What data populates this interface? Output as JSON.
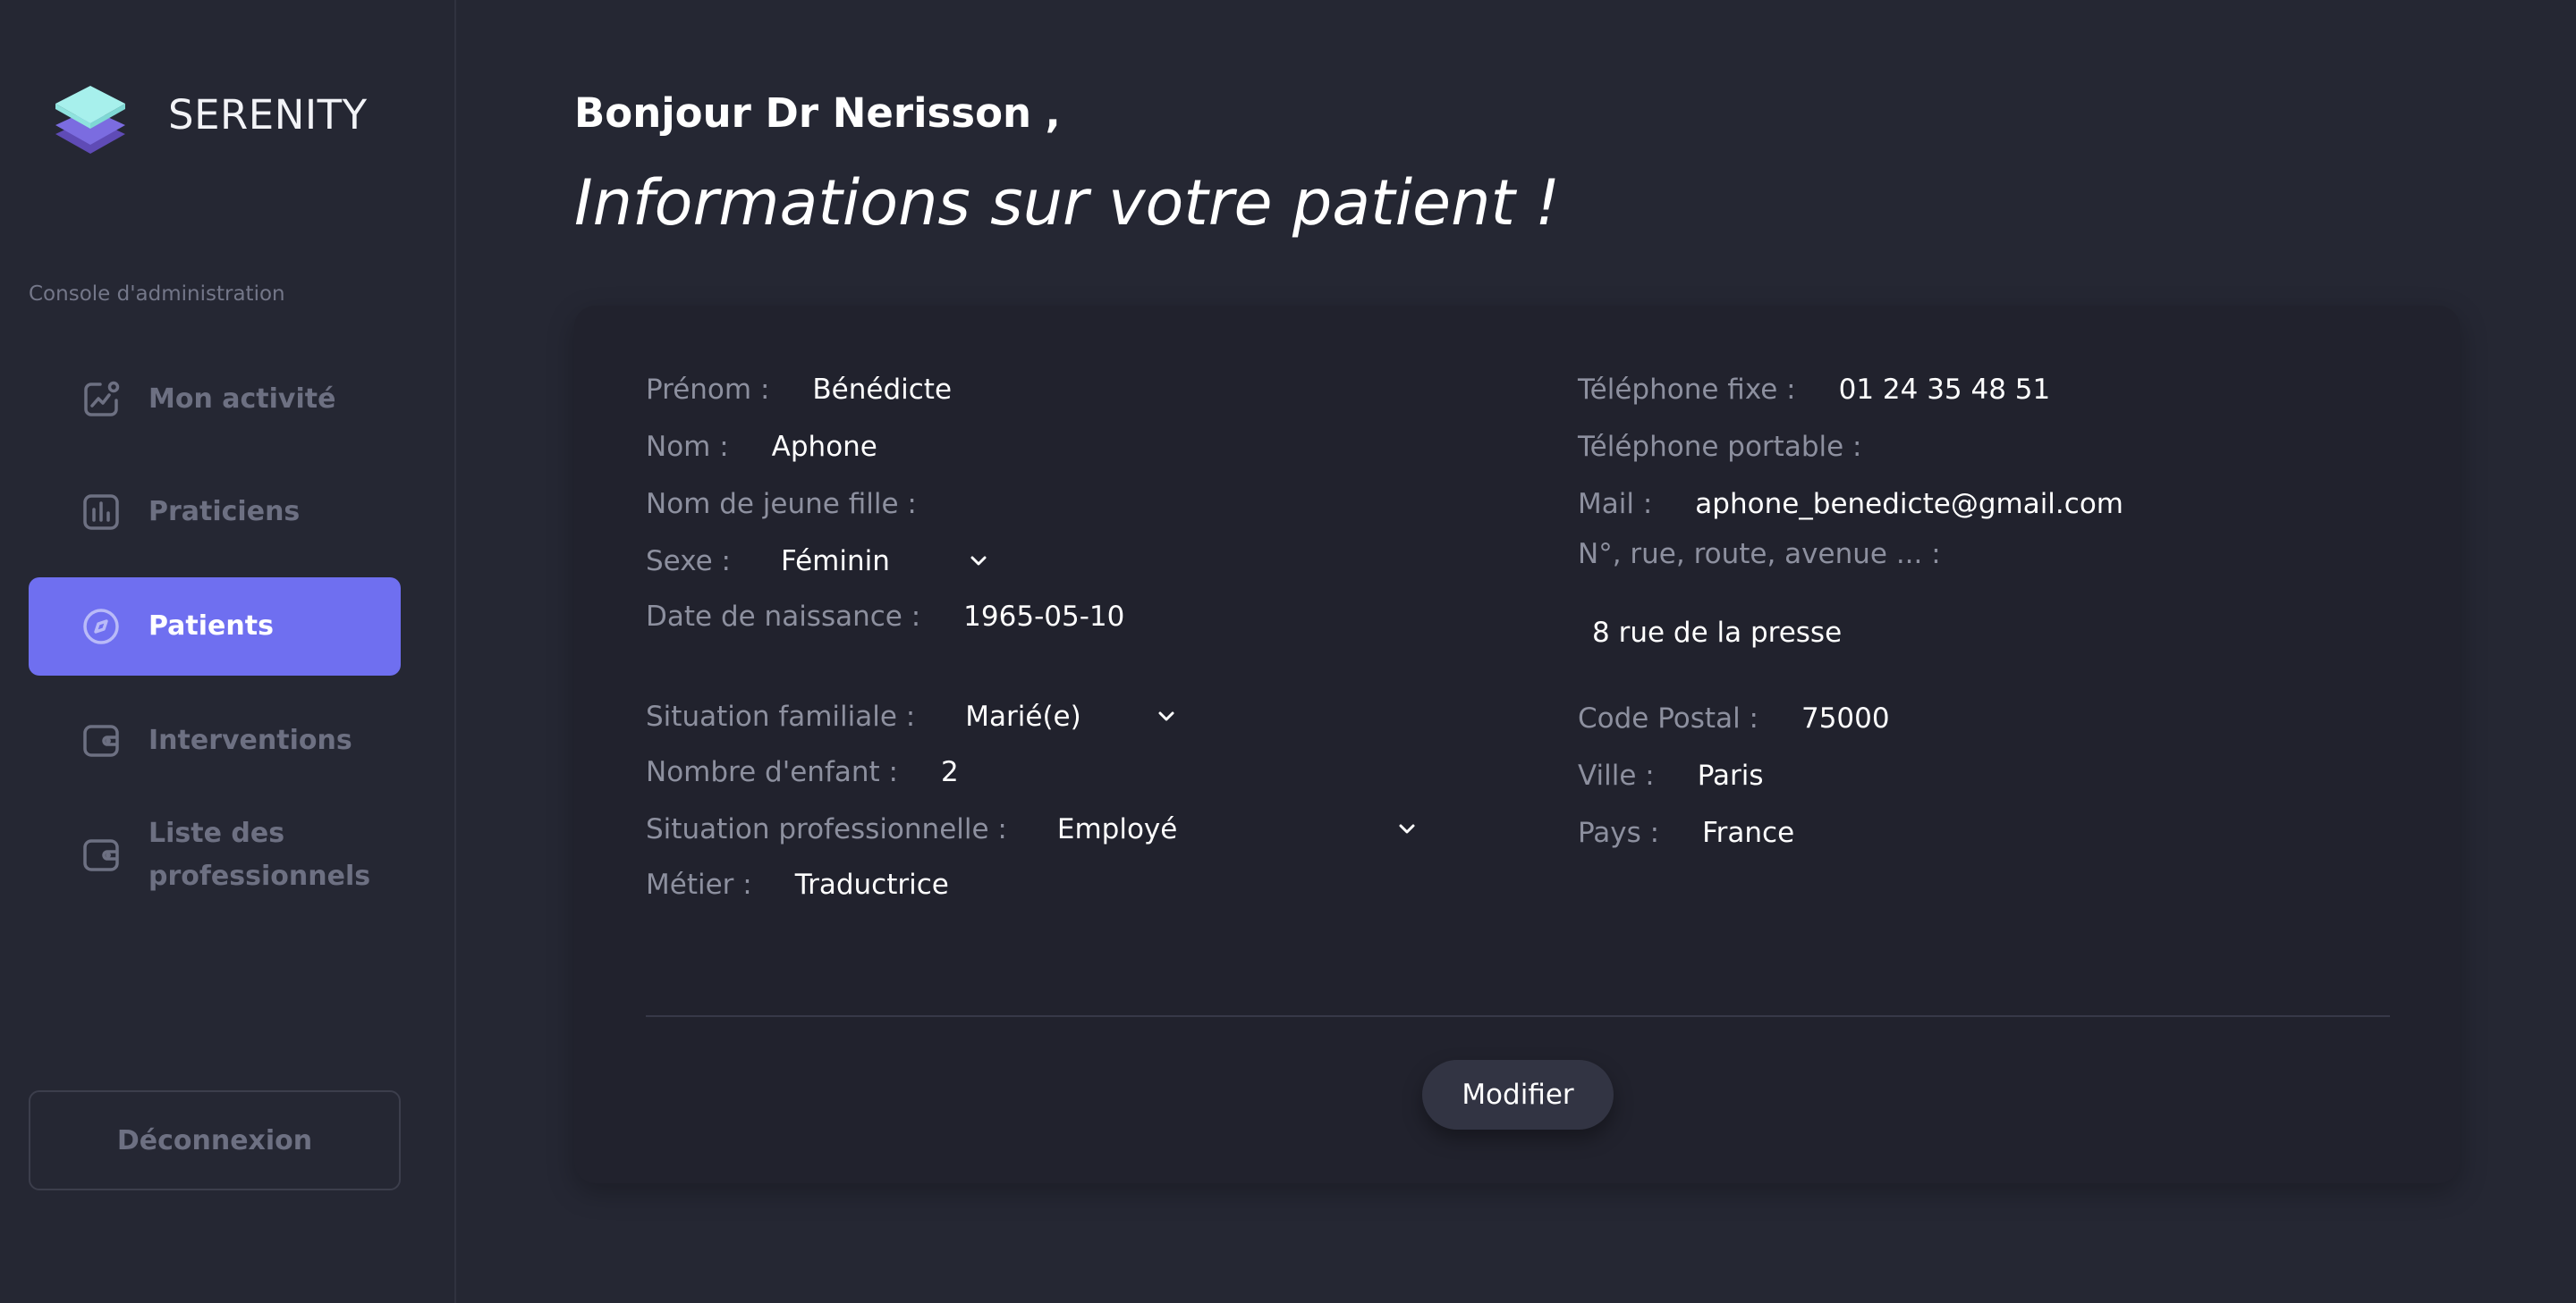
{
  "app": {
    "brand": "SERENITY",
    "console_label": "Console d'administration"
  },
  "sidebar": {
    "items": [
      {
        "label": "Mon activité",
        "icon": "activity-icon"
      },
      {
        "label": "Praticiens",
        "icon": "bar-chart-icon"
      },
      {
        "label": "Patients",
        "icon": "compass-icon",
        "active": true
      },
      {
        "label": "Interventions",
        "icon": "wallet-icon"
      },
      {
        "label": "Liste des professionnels",
        "icon": "wallet-icon"
      }
    ],
    "logout_label": "Déconnexion"
  },
  "header": {
    "greeting": "Bonjour Dr Nerisson ,",
    "subtitle": "Informations sur votre patient !"
  },
  "patient": {
    "prenom": {
      "label": "Prénom :",
      "value": "Bénédicte"
    },
    "nom": {
      "label": "Nom :",
      "value": "Aphone"
    },
    "nom_jeune_fille": {
      "label": "Nom de jeune fille :",
      "value": ""
    },
    "sexe": {
      "label": "Sexe :",
      "value": "Féminin"
    },
    "date_naissance": {
      "label": "Date de naissance :",
      "value": "1965-05-10"
    },
    "situation_familiale": {
      "label": "Situation familiale :",
      "value": "Marié(e)"
    },
    "nombre_enfant": {
      "label": "Nombre d'enfant :",
      "value": "2"
    },
    "situation_pro": {
      "label": "Situation professionnelle :",
      "value": "Employé"
    },
    "metier": {
      "label": "Métier :",
      "value": "Traductrice"
    },
    "tel_fixe": {
      "label": "Téléphone fixe :",
      "value": "01 24 35 48 51"
    },
    "tel_portable": {
      "label": "Téléphone portable :",
      "value": ""
    },
    "mail": {
      "label": "Mail :",
      "value": "aphone_benedicte@gmail.com"
    },
    "adresse": {
      "label": "N°, rue, route, avenue ... :",
      "value": "8 rue de la presse"
    },
    "code_postal": {
      "label": "Code Postal :",
      "value": "75000"
    },
    "ville": {
      "label": "Ville :",
      "value": "Paris"
    },
    "pays": {
      "label": "Pays :",
      "value": "France"
    }
  },
  "actions": {
    "modifier_label": "Modifier"
  },
  "colors": {
    "accent": "#6f6ff0",
    "background": "#252733",
    "card": "#21222d"
  }
}
